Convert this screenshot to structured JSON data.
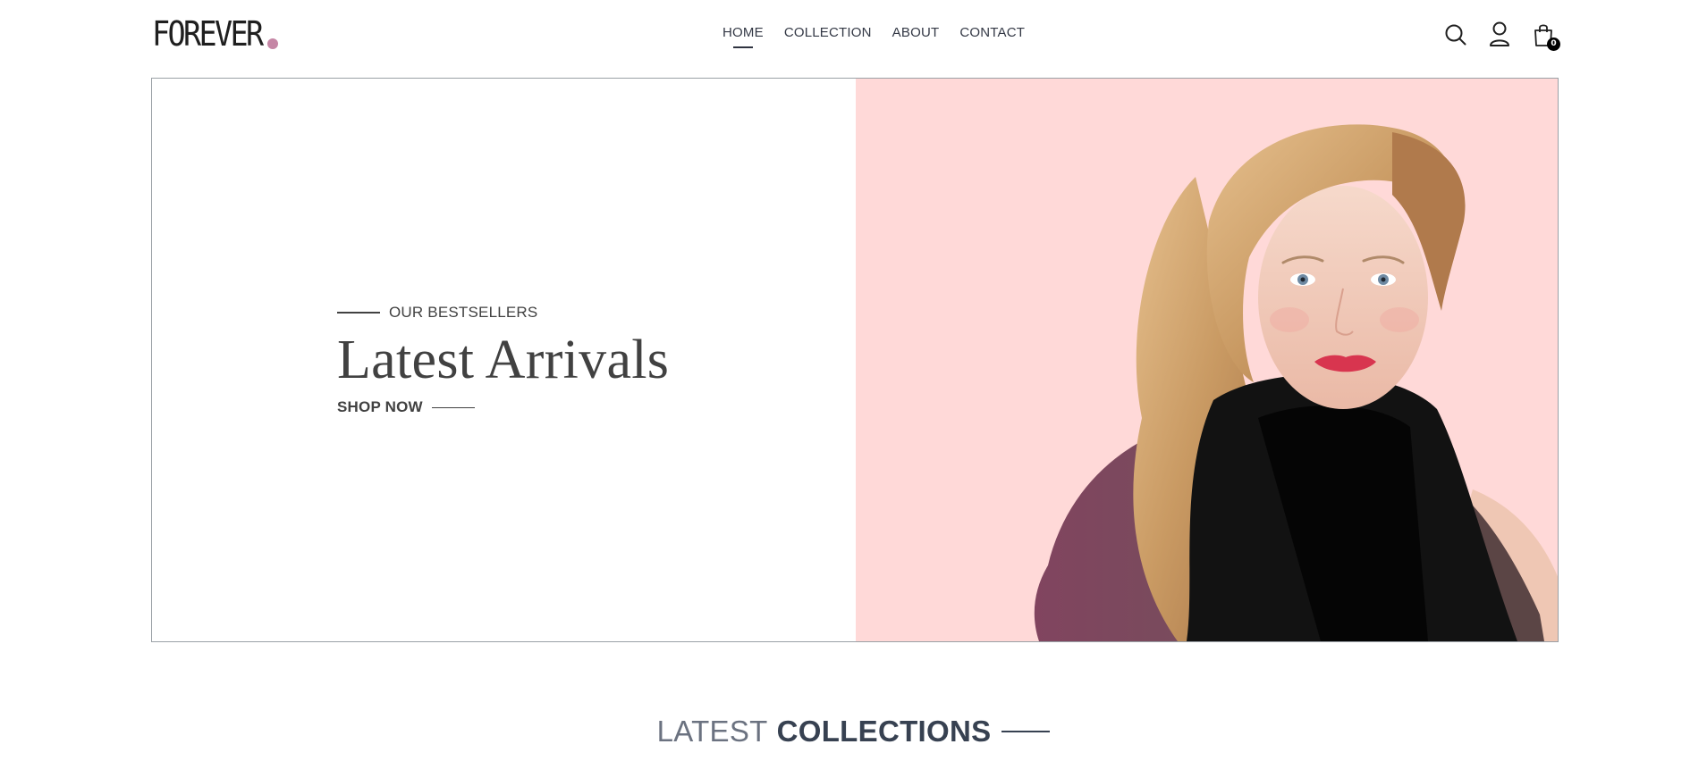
{
  "brand": {
    "logo_text": "FOREVER",
    "logo_dot_color": "#c586a5"
  },
  "nav": {
    "links": [
      {
        "label": "HOME",
        "active": true
      },
      {
        "label": "COLLECTION",
        "active": false
      },
      {
        "label": "ABOUT",
        "active": false
      },
      {
        "label": "CONTACT",
        "active": false
      }
    ],
    "icons": [
      "search-icon",
      "profile-icon",
      "cart-icon"
    ],
    "cart_count": "0"
  },
  "hero": {
    "eyebrow": "OUR BESTSELLERS",
    "title": "Latest Arrivals",
    "cta_label": "SHOP NOW",
    "image_background": "#ffd9d8",
    "image_subject": "hero-model-image"
  },
  "section": {
    "title_light": "LATEST",
    "title_bold": "COLLECTIONS"
  }
}
